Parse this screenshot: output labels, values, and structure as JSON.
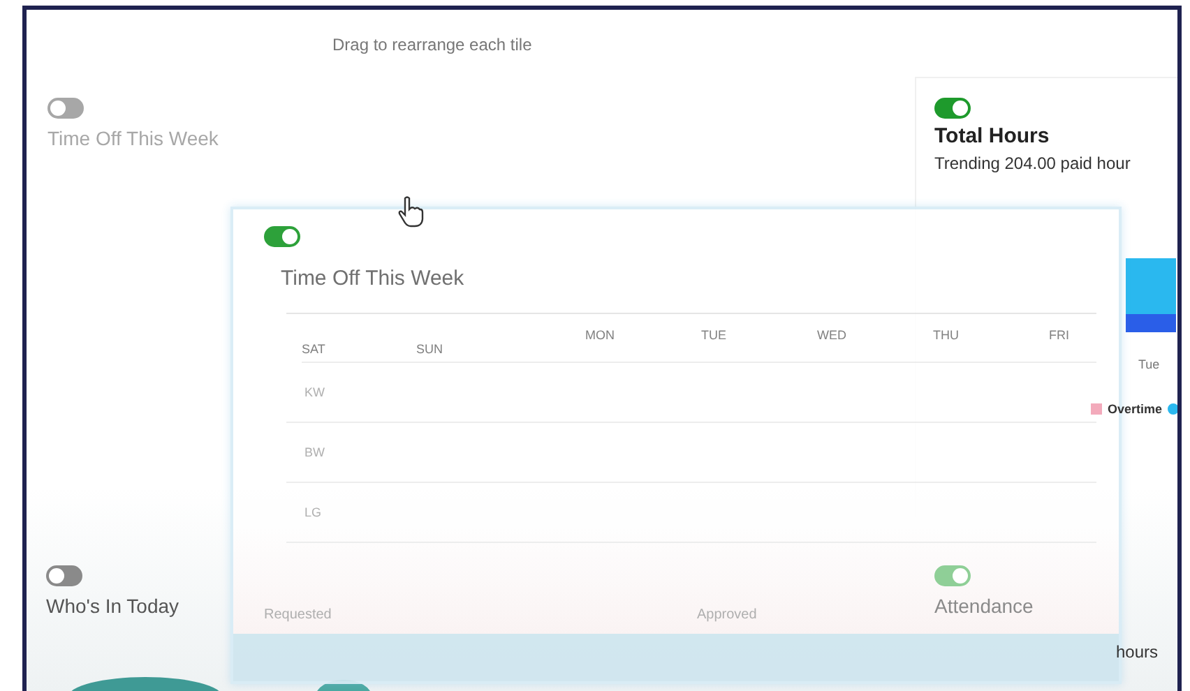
{
  "hint": "Drag to rearrange each tile",
  "time_off_tile": {
    "title": "Time Off This Week",
    "on": false
  },
  "total_hours_tile": {
    "title": "Total Hours",
    "on": true,
    "subtitle": "Trending 204.00 paid hour",
    "axis_label": "Tue",
    "legend": "Overtime"
  },
  "whos_in_tile": {
    "title": "Who's In Today",
    "on": false
  },
  "attendance_tile": {
    "title": "Attendance",
    "on": true,
    "subtitle": "hours"
  },
  "dragged_tile": {
    "title": "Time Off This Week",
    "on": true,
    "weekdays": [
      "MON",
      "TUE",
      "WED",
      "THU",
      "FRI"
    ],
    "weekend": [
      "SAT",
      "SUN"
    ],
    "rows": [
      "KW",
      "BW",
      "LG"
    ],
    "footer": [
      "Requested",
      "Approved"
    ]
  }
}
